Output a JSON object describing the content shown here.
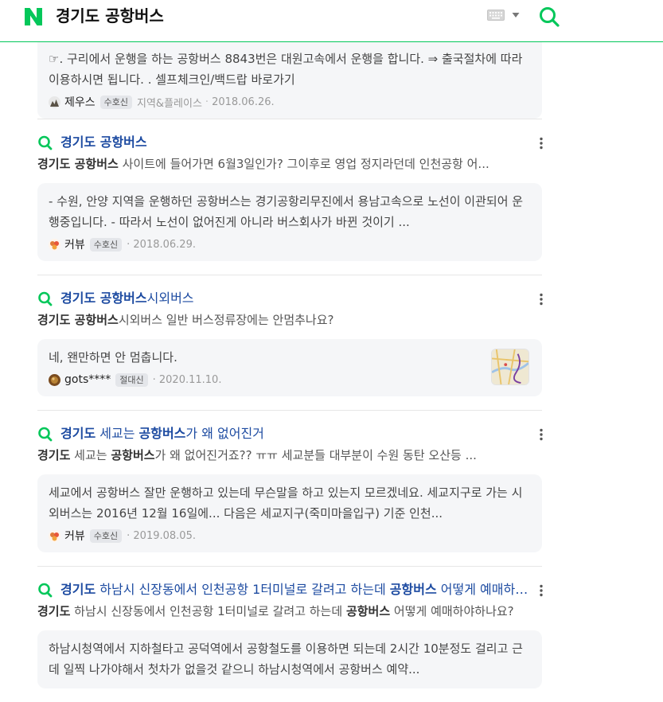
{
  "header": {
    "logo_letter": "N",
    "query": "경기도 공항버스",
    "brand_color": "#03c75a"
  },
  "first_card": {
    "text": "☞. 구리에서 운행을 하는 공항버스 8843번은 대원고속에서 운행을 합니다. ⇒ 출국절차에 따라 이용하시면 됩니다. . 셀프체크인/백드랍 바로가기",
    "user": "제우스",
    "badge": "수호신",
    "category": "지역&플레이스",
    "dot": "·",
    "date": "2018.06.26."
  },
  "results": [
    {
      "title_parts": [
        {
          "t": "경기도 공항버스",
          "b": true
        }
      ],
      "snippet_parts": [
        {
          "t": "경기도 공항버스",
          "b": true
        },
        {
          "t": " 사이트에 들어가면 6월3일인가? 그이후로 영업 정지라던데 인천공항 어...",
          "b": false
        }
      ],
      "answer": "- 수원, 안양 지역을 운행하던 공항버스는 경기공항리무진에서 용남고속으로 노선이 이관되어 운행중입니다. - 따라서 노선이 없어진게 아니라 버스회사가 바뀐 것이기 ...",
      "user": "커뷰",
      "badge": "수호신",
      "date": "2018.06.29.",
      "has_thumb": false
    },
    {
      "title_parts": [
        {
          "t": "경기도 공항버스",
          "b": true
        },
        {
          "t": "시외버스",
          "b": false
        }
      ],
      "snippet_parts": [
        {
          "t": "경기도 공항버스",
          "b": true
        },
        {
          "t": "시외버스 일반 버스정류장에는 안멈추나요?",
          "b": false
        }
      ],
      "answer": "네, 왠만하면 안 멈춥니다.",
      "user": "gots****",
      "badge": "절대신",
      "date": "2020.11.10.",
      "has_thumb": true
    },
    {
      "title_parts": [
        {
          "t": "경기도",
          "b": true
        },
        {
          "t": " 세교는 ",
          "b": false
        },
        {
          "t": "공항버스",
          "b": true
        },
        {
          "t": "가 왜 없어진거",
          "b": false
        }
      ],
      "snippet_parts": [
        {
          "t": "경기도",
          "b": true
        },
        {
          "t": " 세교는 ",
          "b": false
        },
        {
          "t": "공항버스",
          "b": true
        },
        {
          "t": "가 왜 없어진거죠?? ㅠㅠ 세교분들 대부분이 수원 동탄 오산등 ...",
          "b": false
        }
      ],
      "answer": "세교에서 공항버스 잘만 운행하고 있는데 무슨말을 하고 있는지 모르겠네요. 세교지구로 가는 시외버스는 2016년 12월 16일에... 다음은 세교지구(죽미마을입구) 기준 인천...",
      "user": "커뷰",
      "badge": "수호신",
      "date": "2019.08.05.",
      "has_thumb": false
    },
    {
      "title_parts": [
        {
          "t": "경기도",
          "b": true
        },
        {
          "t": " 하남시 신장동에서 인천공항 1터미널로 갈려고 하는데 ",
          "b": false
        },
        {
          "t": "공항버스",
          "b": true
        },
        {
          "t": " 어떻게 예매하야하나요?",
          "b": false
        }
      ],
      "snippet_parts": [
        {
          "t": "경기도",
          "b": true
        },
        {
          "t": " 하남시 신장동에서 인천공항 1터미널로 갈려고 하는데 ",
          "b": false
        },
        {
          "t": "공항버스",
          "b": true
        },
        {
          "t": " 어떻게 예매하야하나요?",
          "b": false
        }
      ],
      "answer": "하남시청역에서 지하철타고 공덕역에서 공항철도를 이용하면 되는데 2시간 10분정도 걸리고 근데 일찍 나가야해서 첫차가 없을것 같으니 하남시청역에서 공항버스 예약...",
      "user": "",
      "badge": "",
      "date": "",
      "has_thumb": false
    }
  ]
}
